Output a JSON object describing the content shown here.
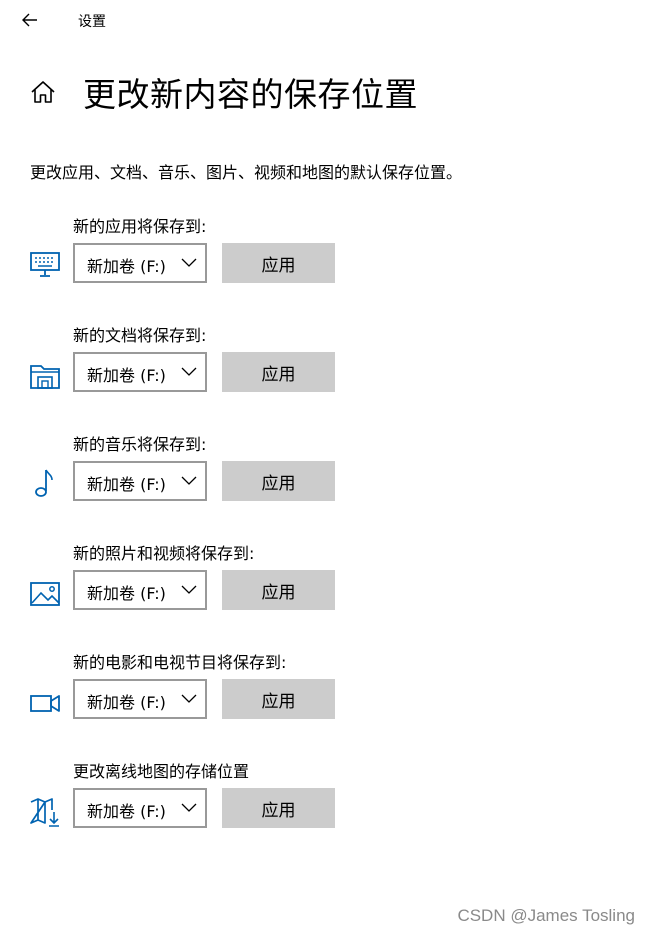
{
  "window": {
    "title": "设置"
  },
  "page": {
    "title": "更改新内容的保存位置",
    "description": "更改应用、文档、音乐、图片、视频和地图的默认保存位置。"
  },
  "accent_color": "#0063b1",
  "sections": [
    {
      "label": "新的应用将保存到:",
      "icon": "monitor-icon",
      "drive": "新加卷 (F:)",
      "button": "应用"
    },
    {
      "label": "新的文档将保存到:",
      "icon": "folder-icon",
      "drive": "新加卷 (F:)",
      "button": "应用"
    },
    {
      "label": "新的音乐将保存到:",
      "icon": "music-note-icon",
      "drive": "新加卷 (F:)",
      "button": "应用"
    },
    {
      "label": "新的照片和视频将保存到:",
      "icon": "picture-icon",
      "drive": "新加卷 (F:)",
      "button": "应用"
    },
    {
      "label": "新的电影和电视节目将保存到:",
      "icon": "video-camera-icon",
      "drive": "新加卷 (F:)",
      "button": "应用"
    },
    {
      "label": "更改离线地图的存储位置",
      "icon": "map-download-icon",
      "drive": "新加卷 (F:)",
      "button": "应用"
    }
  ],
  "watermark": "CSDN @James Tosling"
}
